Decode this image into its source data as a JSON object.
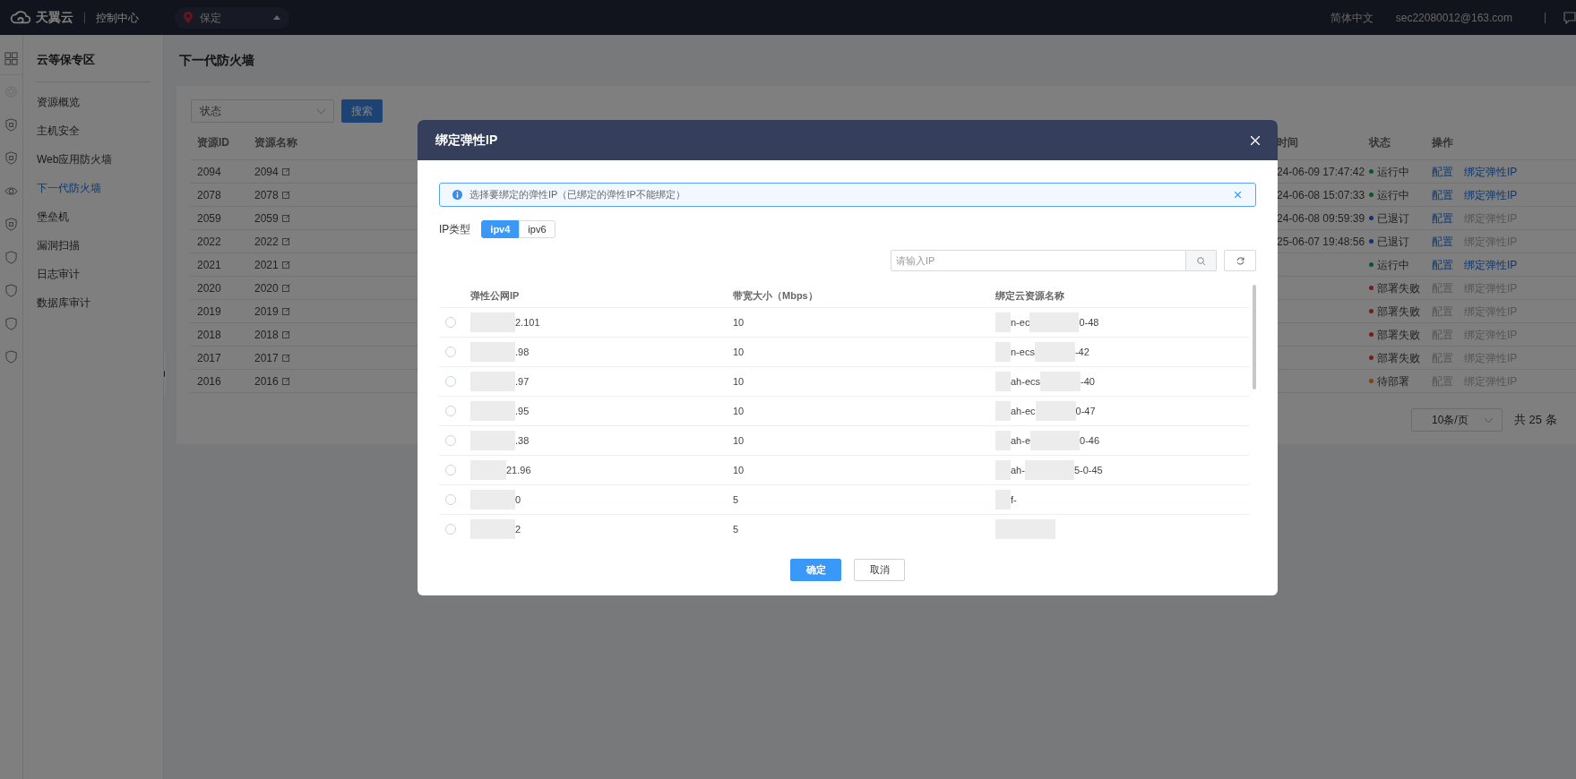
{
  "top_bar": {
    "logo_text": "天翼云",
    "console": "控制中心",
    "region": "保定",
    "language": "简体中文",
    "account": "sec22080012@163.com"
  },
  "icon_rail": {
    "items": [
      {
        "kind": "grid"
      },
      {
        "kind": "faint"
      },
      {
        "kind": "shield"
      },
      {
        "kind": "shield"
      },
      {
        "kind": "eye"
      },
      {
        "kind": "shield"
      },
      {
        "kind": "plain"
      },
      {
        "kind": "plain"
      },
      {
        "kind": "plain"
      },
      {
        "kind": "plain"
      }
    ]
  },
  "sidebar": {
    "title": "云等保专区",
    "items": [
      {
        "label": "资源概览",
        "selected": false
      },
      {
        "label": "主机安全",
        "selected": false
      },
      {
        "label": "Web应用防火墙",
        "selected": false
      },
      {
        "label": "下一代防火墙",
        "selected": true
      },
      {
        "label": "堡垒机",
        "selected": false
      },
      {
        "label": "漏洞扫描",
        "selected": false
      },
      {
        "label": "日志审计",
        "selected": false
      },
      {
        "label": "数据库审计",
        "selected": false
      }
    ]
  },
  "page": {
    "title": "下一代防火墙",
    "filter": {
      "placeholder": "状态"
    },
    "search_button": "搜索",
    "table": {
      "columns": [
        "资源ID",
        "资源名称",
        "时间",
        "状态",
        "操作"
      ],
      "rows": [
        {
          "id": "2094",
          "name": "2094",
          "time": "24-06-09 17:47:42",
          "status": "运行中",
          "color": "#11522e",
          "actions": [
            {
              "label": "配置",
              "enabled": true
            },
            {
              "label": "绑定弹性IP",
              "enabled": true
            }
          ]
        },
        {
          "id": "2078",
          "name": "2078",
          "time": "24-06-08 15:07:33",
          "status": "运行中",
          "color": "#11522e",
          "actions": [
            {
              "label": "配置",
              "enabled": true
            },
            {
              "label": "绑定弹性IP",
              "enabled": true
            }
          ]
        },
        {
          "id": "2059",
          "name": "2059",
          "time": "24-06-08 09:59:39",
          "status": "已退订",
          "color": "#182e6e",
          "actions": [
            {
              "label": "配置",
              "enabled": true
            },
            {
              "label": "绑定弹性IP",
              "enabled": false
            }
          ]
        },
        {
          "id": "2022",
          "name": "2022",
          "time": "25-06-07 19:48:56",
          "status": "已退订",
          "color": "#182e6e",
          "actions": [
            {
              "label": "配置",
              "enabled": true
            },
            {
              "label": "绑定弹性IP",
              "enabled": false
            }
          ]
        },
        {
          "id": "2021",
          "name": "2021",
          "status": "运行中",
          "color": "#11522e",
          "actions": [
            {
              "label": "配置",
              "enabled": true
            },
            {
              "label": "绑定弹性IP",
              "enabled": true
            }
          ]
        },
        {
          "id": "2020",
          "name": "2020",
          "status": "部署失败",
          "color": "#701e1e",
          "actions": [
            {
              "label": "配置",
              "enabled": false
            },
            {
              "label": "绑定弹性IP",
              "enabled": false
            }
          ]
        },
        {
          "id": "2019",
          "name": "2019",
          "status": "部署失败",
          "color": "#701e1e",
          "actions": [
            {
              "label": "配置",
              "enabled": false
            },
            {
              "label": "绑定弹性IP",
              "enabled": false
            }
          ]
        },
        {
          "id": "2018",
          "name": "2018",
          "status": "部署失败",
          "color": "#701e1e",
          "actions": [
            {
              "label": "配置",
              "enabled": false
            },
            {
              "label": "绑定弹性IP",
              "enabled": false
            }
          ]
        },
        {
          "id": "2017",
          "name": "2017",
          "status": "部署失败",
          "color": "#701e1e",
          "actions": [
            {
              "label": "配置",
              "enabled": false
            },
            {
              "label": "绑定弹性IP",
              "enabled": false
            }
          ]
        },
        {
          "id": "2016",
          "name": "2016",
          "status": "待部署",
          "color": "#784512",
          "actions": [
            {
              "label": "配置",
              "enabled": false
            },
            {
              "label": "绑定弹性IP",
              "enabled": false
            }
          ]
        }
      ]
    },
    "pagination": {
      "page_size": "10条/页",
      "total": "共 25 条"
    }
  },
  "dialog": {
    "title": "绑定弹性IP",
    "notice": "选择要绑定的弹性IP（已绑定的弹性IP不能绑定）",
    "ip_type_label": "IP类型",
    "ip_types": [
      {
        "label": "ipv4",
        "selected": true
      },
      {
        "label": "ipv6",
        "selected": false
      }
    ],
    "search": {
      "placeholder": "请输入IP"
    },
    "table": {
      "columns": [
        "弹性公网IP",
        "带宽大小（Mbps）",
        "绑定云资源名称"
      ],
      "rows": [
        {
          "selected": false,
          "ip": "2.101",
          "bandwidth": "10",
          "name_parts": [
            "n-ec",
            "0-48"
          ]
        },
        {
          "selected": false,
          "ip": ".98",
          "bandwidth": "10",
          "name_parts": [
            "n-ecs",
            "-42"
          ]
        },
        {
          "selected": false,
          "ip": ".97",
          "bandwidth": "10",
          "name_parts": [
            "ah-ecs",
            "-40"
          ]
        },
        {
          "selected": false,
          "ip": ".95",
          "bandwidth": "10",
          "name_parts": [
            "ah-ec",
            "0-47"
          ]
        },
        {
          "selected": false,
          "ip": ".38",
          "bandwidth": "10",
          "name_parts": [
            "ah-e",
            "0-46"
          ]
        },
        {
          "selected": false,
          "ip": "21.96",
          "bandwidth": "10",
          "name_parts": [
            "ah-",
            "5-0-45"
          ]
        },
        {
          "selected": false,
          "ip": "0",
          "bandwidth": "5",
          "name_parts": [
            "f-"
          ]
        },
        {
          "selected": false,
          "ip": "2",
          "bandwidth": "5"
        }
      ]
    },
    "buttons": [
      {
        "label": "确定",
        "kind": "primary"
      },
      {
        "label": "取消",
        "kind": "default"
      }
    ]
  }
}
